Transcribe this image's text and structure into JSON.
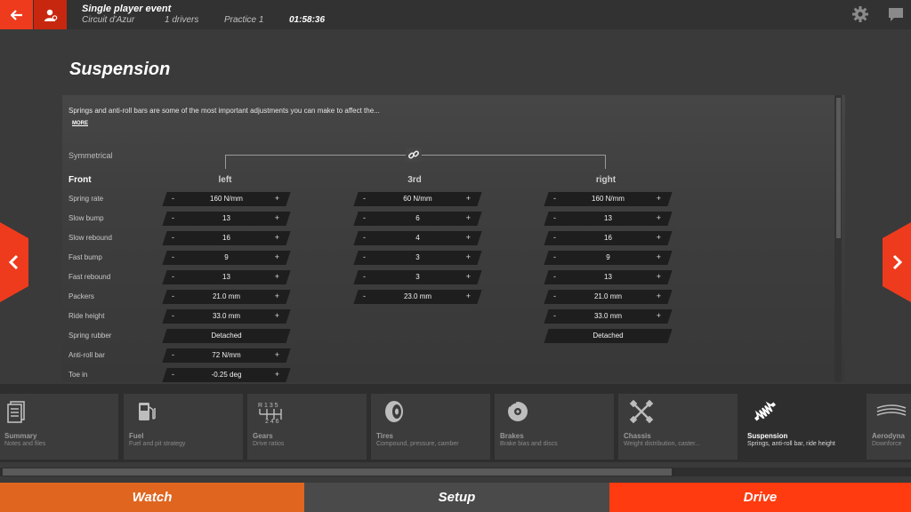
{
  "header": {
    "event_title": "Single player event",
    "track": "Circuit d'Azur",
    "drivers": "1 drivers",
    "session": "Practice 1",
    "time": "01:58:36"
  },
  "page": {
    "title": "Suspension",
    "description": "Springs and anti-roll bars are some of the most important adjustments you can make to affect the...",
    "more_label": "MORE",
    "symmetrical_label": "Symmetrical",
    "section_label": "Front",
    "columns": {
      "left": "left",
      "third": "3rd",
      "right": "right"
    }
  },
  "rows": [
    {
      "label": "Spring rate",
      "left": "160 N/mm",
      "third": "60 N/mm",
      "right": "160 N/mm"
    },
    {
      "label": "Slow bump",
      "left": "13",
      "third": "6",
      "right": "13"
    },
    {
      "label": "Slow rebound",
      "left": "16",
      "third": "4",
      "right": "16"
    },
    {
      "label": "Fast bump",
      "left": "9",
      "third": "3",
      "right": "9"
    },
    {
      "label": "Fast rebound",
      "left": "13",
      "third": "3",
      "right": "13"
    },
    {
      "label": "Packers",
      "left": "21.0 mm",
      "third": "23.0 mm",
      "right": "21.0 mm"
    },
    {
      "label": "Ride height",
      "left": "33.0 mm",
      "third": "",
      "right": "33.0 mm"
    },
    {
      "label": "Spring rubber",
      "left": "Detached",
      "third": "",
      "right": "Detached"
    },
    {
      "label": "Anti-roll bar",
      "left": "72 N/mm",
      "third": "",
      "right": ""
    },
    {
      "label": "Toe in",
      "left": "-0.25 deg",
      "third": "",
      "right": ""
    }
  ],
  "stepper_symbols": {
    "minus": "-",
    "plus": "+"
  },
  "tabs": [
    {
      "title": "Summary",
      "subtitle": "Notes and files",
      "icon": "document-icon"
    },
    {
      "title": "Fuel",
      "subtitle": "Fuel and pit strategy",
      "icon": "fuel-pump-icon"
    },
    {
      "title": "Gears",
      "subtitle": "Drive ratios",
      "icon": "gearbox-icon"
    },
    {
      "title": "Tires",
      "subtitle": "Compound, pressure, camber",
      "icon": "tire-icon"
    },
    {
      "title": "Brakes",
      "subtitle": "Brake bias and discs",
      "icon": "brake-disc-icon"
    },
    {
      "title": "Chassis",
      "subtitle": "Weight distribution, caster...",
      "icon": "chassis-icon"
    },
    {
      "title": "Suspension",
      "subtitle": "Springs, anti-roll bar, ride height",
      "icon": "spring-icon"
    },
    {
      "title": "Aerodyna",
      "subtitle": "Downforce",
      "icon": "wing-icon"
    }
  ],
  "gear_icon_text": "R 1 3 5 / 2 4 6",
  "bottom": {
    "watch": "Watch",
    "setup": "Setup",
    "drive": "Drive"
  },
  "colors": {
    "accent": "#ee3b1d",
    "watch": "#e0651f",
    "setup": "#4a4a4a",
    "drive": "#ff3b0f"
  }
}
